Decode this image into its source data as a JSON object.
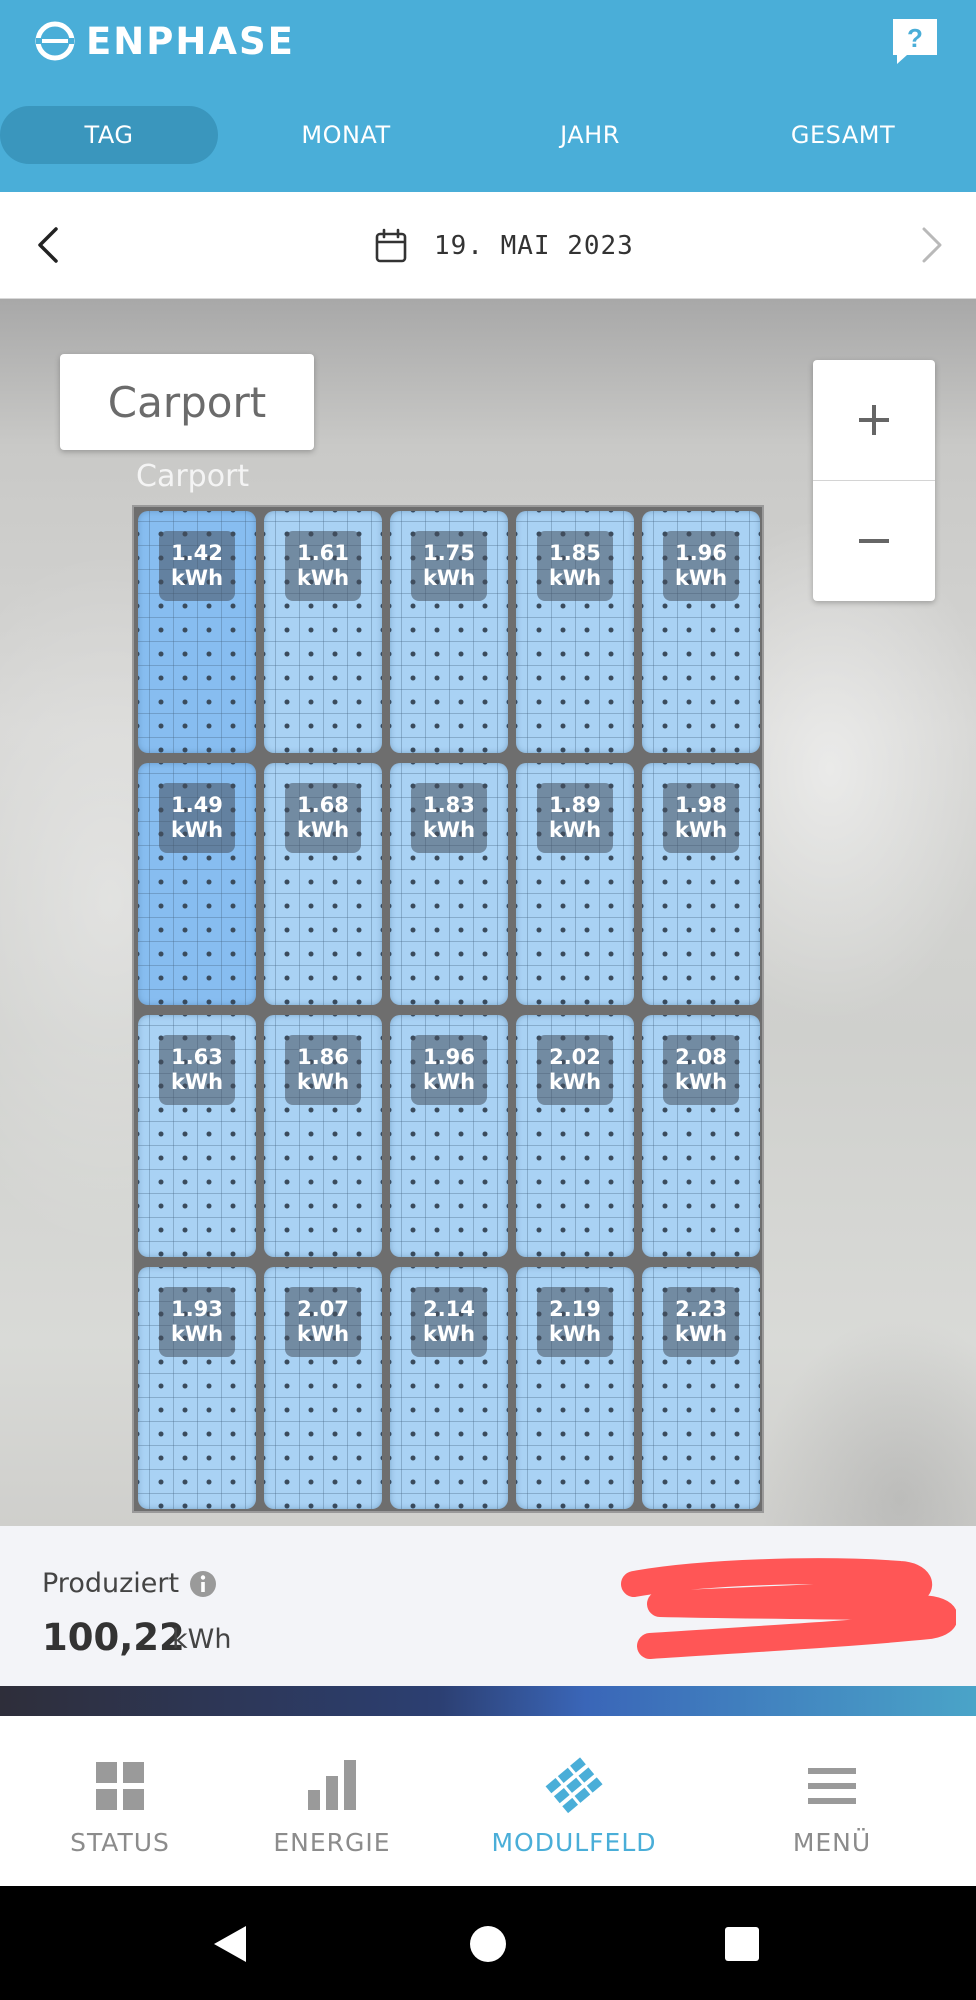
{
  "header": {
    "brand": "ENPHASE",
    "help_icon": "help-question-icon",
    "tabs": [
      {
        "label": "TAG",
        "active": true
      },
      {
        "label": "MONAT",
        "active": false
      },
      {
        "label": "JAHR",
        "active": false
      },
      {
        "label": "GESAMT",
        "active": false
      }
    ],
    "colors": {
      "header_bg": "#4aaed8",
      "active_tab_bg": "#3a96bd"
    }
  },
  "date_bar": {
    "date": "19. MAI 2023",
    "prev_icon": "chevron-left-icon",
    "next_icon": "chevron-right-icon",
    "calendar_icon": "calendar-icon"
  },
  "map": {
    "label_card": "Carport",
    "array_name": "Carport",
    "zoom_in": "+",
    "zoom_out": "−",
    "unit": "kWh",
    "panels": [
      [
        "1.42",
        "1.61",
        "1.75",
        "1.85",
        "1.96"
      ],
      [
        "1.49",
        "1.68",
        "1.83",
        "1.89",
        "1.98"
      ],
      [
        "1.63",
        "1.86",
        "1.96",
        "2.02",
        "2.08"
      ],
      [
        "1.93",
        "2.07",
        "2.14",
        "2.19",
        "2.23"
      ]
    ]
  },
  "produced": {
    "label": "Produziert",
    "value": "100,22",
    "unit": "kWh",
    "info_icon": "info-icon"
  },
  "nav": {
    "items": [
      {
        "label": "STATUS",
        "icon": "status-grid-icon",
        "active": false
      },
      {
        "label": "ENERGIE",
        "icon": "energy-bars-icon",
        "active": false
      },
      {
        "label": "MODULFELD",
        "icon": "module-array-icon",
        "active": true
      },
      {
        "label": "MENÜ",
        "icon": "menu-icon",
        "active": false
      }
    ],
    "colors": {
      "active": "#4aaed8",
      "inactive": "#8c8c8c"
    }
  }
}
